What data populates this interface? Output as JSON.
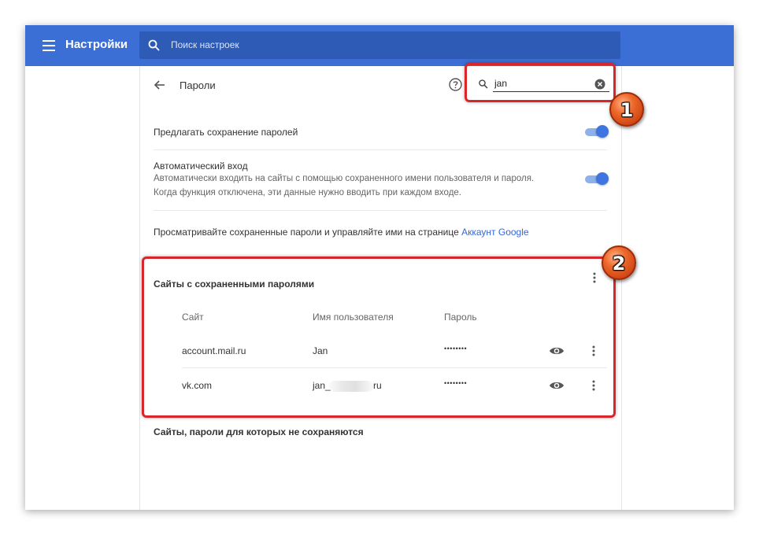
{
  "header": {
    "app_title": "Настройки",
    "search_placeholder": "Поиск настроек",
    "accent_color": "#3b6fd6"
  },
  "passwords_page": {
    "title": "Пароли",
    "filter_value": "jan",
    "offer_to_save": {
      "label": "Предлагать сохранение паролей",
      "enabled": true
    },
    "auto_sign_in": {
      "label": "Автоматический вход",
      "description_line1": "Автоматически входить на сайты с помощью сохраненного имени пользователя и пароля.",
      "description_line2": "Когда функция отключена, эти данные нужно вводить при каждом входе.",
      "enabled": true
    },
    "manage_text": "Просматривайте сохраненные пароли и управляйте ими на странице",
    "manage_link": "Аккаунт Google",
    "saved_section": {
      "title": "Сайты с сохраненными паролями",
      "columns": [
        "Сайт",
        "Имя пользователя",
        "Пароль"
      ],
      "rows": [
        {
          "site": "account.mail.ru",
          "username": "Jan",
          "password": "••••••••"
        },
        {
          "site": "vk.com",
          "username_prefix": "jan_",
          "username_suffix": "ru",
          "password": "••••••••"
        }
      ]
    },
    "never_saved_title": "Сайты, пароли для которых не сохраняются"
  },
  "annotations": {
    "badge1": "1",
    "badge2": "2",
    "highlight_color": "#d9262b"
  },
  "icons": [
    "menu-icon",
    "search-icon",
    "back-arrow-icon",
    "help-icon",
    "clear-icon",
    "eye-icon",
    "more-vert-icon"
  ]
}
